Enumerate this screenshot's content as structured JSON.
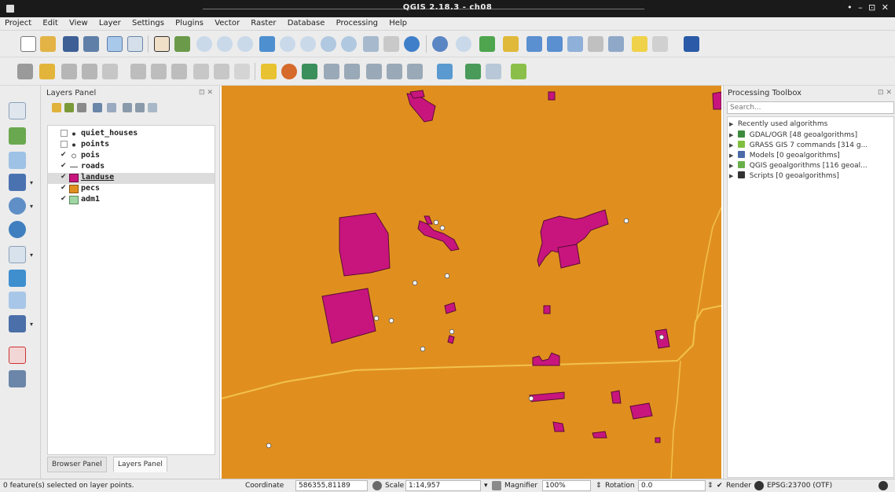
{
  "window": {
    "title": "QGIS 2.18.3 - ch08",
    "controls": "• – ⊡ ✕"
  },
  "menu": [
    "Project",
    "Edit",
    "View",
    "Layer",
    "Settings",
    "Plugins",
    "Vector",
    "Raster",
    "Database",
    "Processing",
    "Help"
  ],
  "layers_panel": {
    "title": "Layers Panel",
    "controls": "⊡ ✕",
    "layers": [
      {
        "name": "quiet_houses",
        "checked": false,
        "symbol": "point"
      },
      {
        "name": "points",
        "checked": false,
        "symbol": "point"
      },
      {
        "name": "pois",
        "checked": true,
        "symbol": "point-hollow"
      },
      {
        "name": "roads",
        "checked": true,
        "symbol": "line"
      },
      {
        "name": "landuse",
        "checked": true,
        "symbol": "fill-magenta",
        "selected": true
      },
      {
        "name": "pecs",
        "checked": true,
        "symbol": "fill-orange"
      },
      {
        "name": "adm1",
        "checked": true,
        "symbol": "fill-green"
      }
    ],
    "tabs": [
      "Browser Panel",
      "Layers Panel"
    ]
  },
  "processing_panel": {
    "title": "Processing Toolbox",
    "controls": "⊡ ✕",
    "search_placeholder": "Search...",
    "items": [
      {
        "label": "Recently used algorithms",
        "icon": "none"
      },
      {
        "label": "GDAL/OGR [48 geoalgorithms]",
        "icon": "gdal-icon"
      },
      {
        "label": "GRASS GIS 7 commands [314 g...",
        "icon": "grass-icon"
      },
      {
        "label": "Models [0 geoalgorithms]",
        "icon": "models-icon"
      },
      {
        "label": "QGIS geoalgorithms [116 geoal...",
        "icon": "qgis-icon"
      },
      {
        "label": "Scripts [0 geoalgorithms]",
        "icon": "scripts-icon"
      }
    ]
  },
  "statusbar": {
    "message": "0 feature(s) selected on layer points.",
    "coordinate_label": "Coordinate",
    "coordinate_value": "586355,81189",
    "scale_label": "Scale",
    "scale_value": "1:14,957",
    "magnifier_label": "Magnifier",
    "magnifier_value": "100%",
    "rotation_label": "Rotation",
    "rotation_value": "0.0",
    "render_label": "Render",
    "crs_label": "EPSG:23700 (OTF)"
  },
  "colors": {
    "map_background": "#e08f1f",
    "landuse_fill": "#c8157e",
    "road": "#f2c24a",
    "titlebar": "#1a1a1a"
  }
}
